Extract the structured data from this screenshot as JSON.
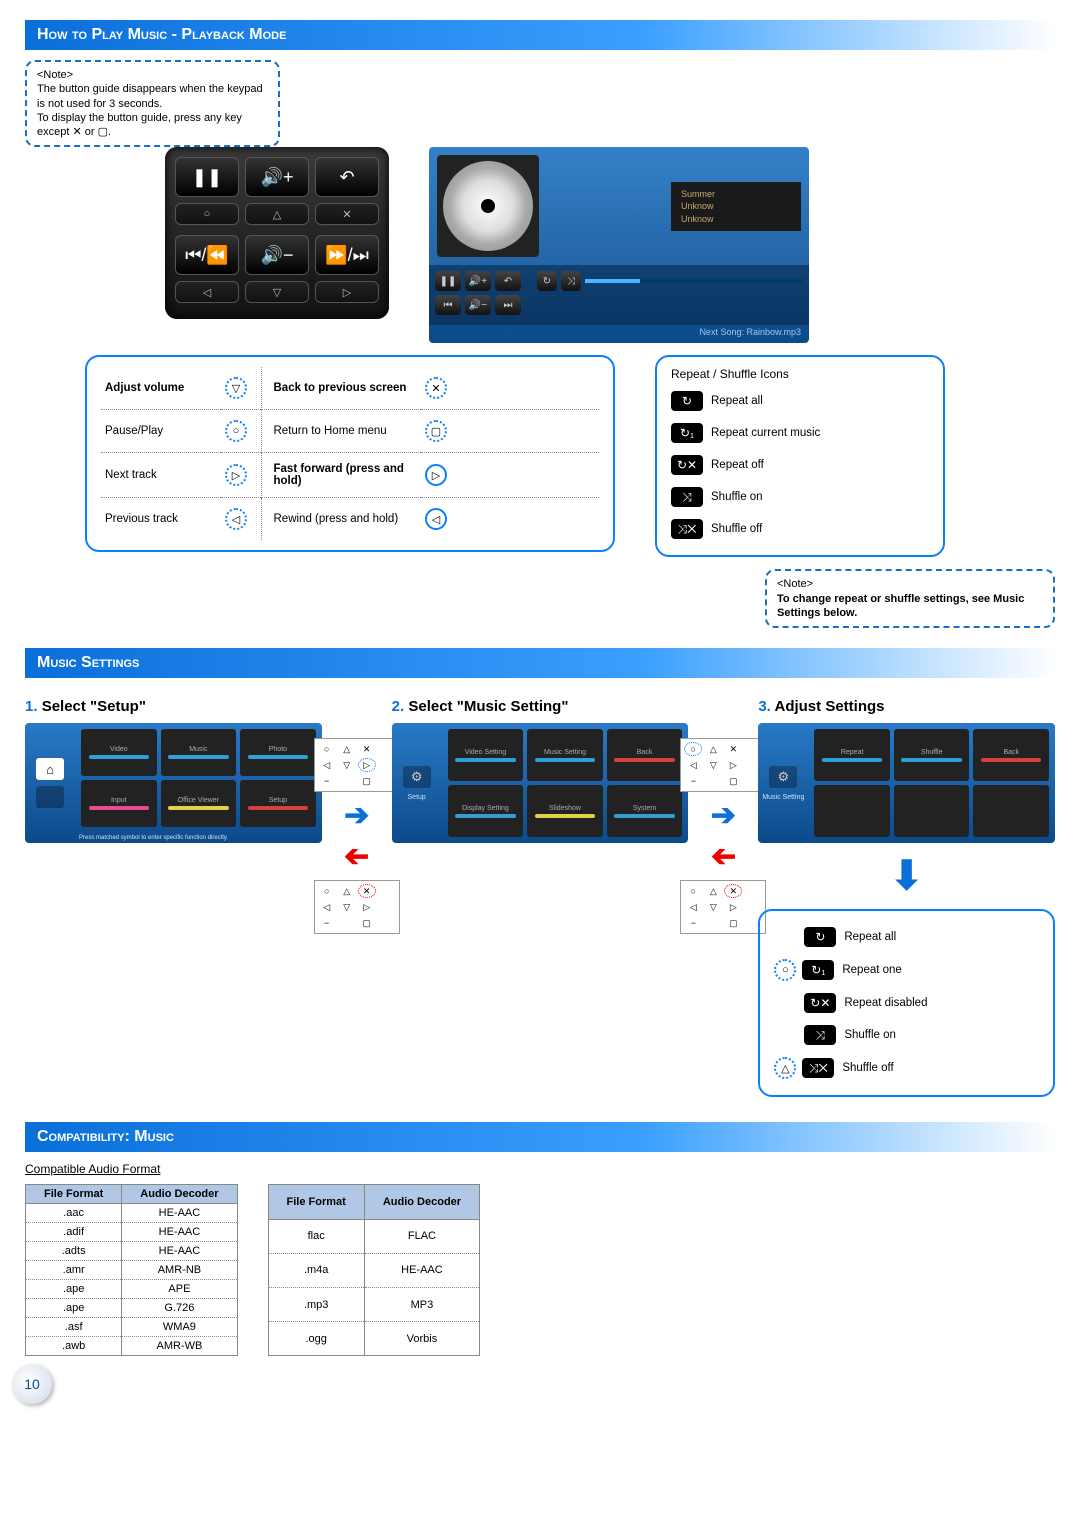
{
  "page_number": "10",
  "header1": "How to Play Music - Playback Mode",
  "header2": "Music Settings",
  "header3": "Compatibility: Music",
  "note1": {
    "tag": "<Note>",
    "l1": "The button guide disappears when the keypad is not used for 3 seconds.",
    "l2": "To display the button guide, press any key except ✕ or ▢."
  },
  "player": {
    "track1": "Summer",
    "track2": "Unknow",
    "track3": "Unknow",
    "next": "Next Song: Rainbow.mp3"
  },
  "button_legend": {
    "r0c0": "Adjust volume",
    "r0c1": "▽",
    "r0c2": "Back to previous screen",
    "r0c3": "✕",
    "r1c0": "Pause/Play",
    "r1c1": "○",
    "r1c2": "Return to Home menu",
    "r1c3": "▢",
    "r2c0": "Next track",
    "r2c1": "▷",
    "r2c2": "Fast forward (press and hold)",
    "r2c3": "▷",
    "r3c0": "Previous track",
    "r3c1": "◁",
    "r3c2": "Rewind (press and hold)",
    "r3c3": "◁"
  },
  "rs_legend": {
    "title": "Repeat / Shuffle Icons",
    "items": [
      {
        "icon": "↻",
        "label": "Repeat all"
      },
      {
        "icon": "↻₁",
        "label": "Repeat current music"
      },
      {
        "icon": "↻✕",
        "label": "Repeat off"
      },
      {
        "icon": "⤨",
        "label": "Shuffle on"
      },
      {
        "icon": "⤨✕",
        "label": "Shuffle off"
      }
    ]
  },
  "note2": {
    "tag": "<Note>",
    "l1": "To change repeat or shuffle settings, see Music Settings below."
  },
  "steps": {
    "s1": {
      "num": "1.",
      "title": "Select \"Setup\""
    },
    "s2": {
      "num": "2.",
      "title": "Select \"Music Setting\""
    },
    "s3": {
      "num": "3.",
      "title": "Adjust Settings"
    }
  },
  "thumb1": {
    "cells": [
      "Video",
      "Music",
      "Photo",
      "Input",
      "Office Viewer",
      "Setup"
    ],
    "bars": [
      "#2ea0d6",
      "#2ea0d6",
      "#2ea0d6",
      "#e74c8b",
      "#e0d24a",
      "#d64040"
    ],
    "note": "Press matched symbol to enter specific function directly."
  },
  "thumb2": {
    "side": "Setup",
    "cells": [
      "Video Setting",
      "Music Setting",
      "Back",
      "Display Setting",
      "Slideshow",
      "System"
    ],
    "bars": [
      "#2ea0d6",
      "#2ea0d6",
      "#d64040",
      "#2ea0d6",
      "#e0d24a",
      "#2ea0d6"
    ]
  },
  "thumb3": {
    "side": "Music Setting",
    "cells": [
      "Repeat",
      "Shuffle",
      "Back",
      "",
      "",
      ""
    ],
    "bars": [
      "#2ea0d6",
      "#2ea0d6",
      "#d64040",
      "",
      "",
      ""
    ]
  },
  "adjust_legend": {
    "items": [
      {
        "btn": "",
        "icon": "↻",
        "label": "Repeat all"
      },
      {
        "btn": "○",
        "icon": "↻₁",
        "label": "Repeat one"
      },
      {
        "btn": "",
        "icon": "↻✕",
        "label": "Repeat disabled"
      },
      {
        "btn": "",
        "icon": "⤨",
        "label": "Shuffle on"
      },
      {
        "btn": "△",
        "icon": "⤨✕",
        "label": "Shuffle off"
      }
    ]
  },
  "compat": {
    "subtitle": "Compatible Audio Format",
    "h1": "File Format",
    "h2": "Audio Decoder",
    "t1": [
      {
        "f": ".aac",
        "d": "HE-AAC"
      },
      {
        "f": ".adif",
        "d": "HE-AAC"
      },
      {
        "f": ".adts",
        "d": "HE-AAC"
      },
      {
        "f": ".amr",
        "d": "AMR-NB"
      },
      {
        "f": ".ape",
        "d": "APE"
      },
      {
        "f": ".ape",
        "d": "G.726"
      },
      {
        "f": ".asf",
        "d": "WMA9"
      },
      {
        "f": ".awb",
        "d": "AMR-WB"
      }
    ],
    "t2": [
      {
        "f": "flac",
        "d": "FLAC"
      },
      {
        "f": ".m4a",
        "d": "HE-AAC"
      },
      {
        "f": ".mp3",
        "d": "MP3"
      },
      {
        "f": ".ogg",
        "d": "Vorbis"
      }
    ]
  }
}
